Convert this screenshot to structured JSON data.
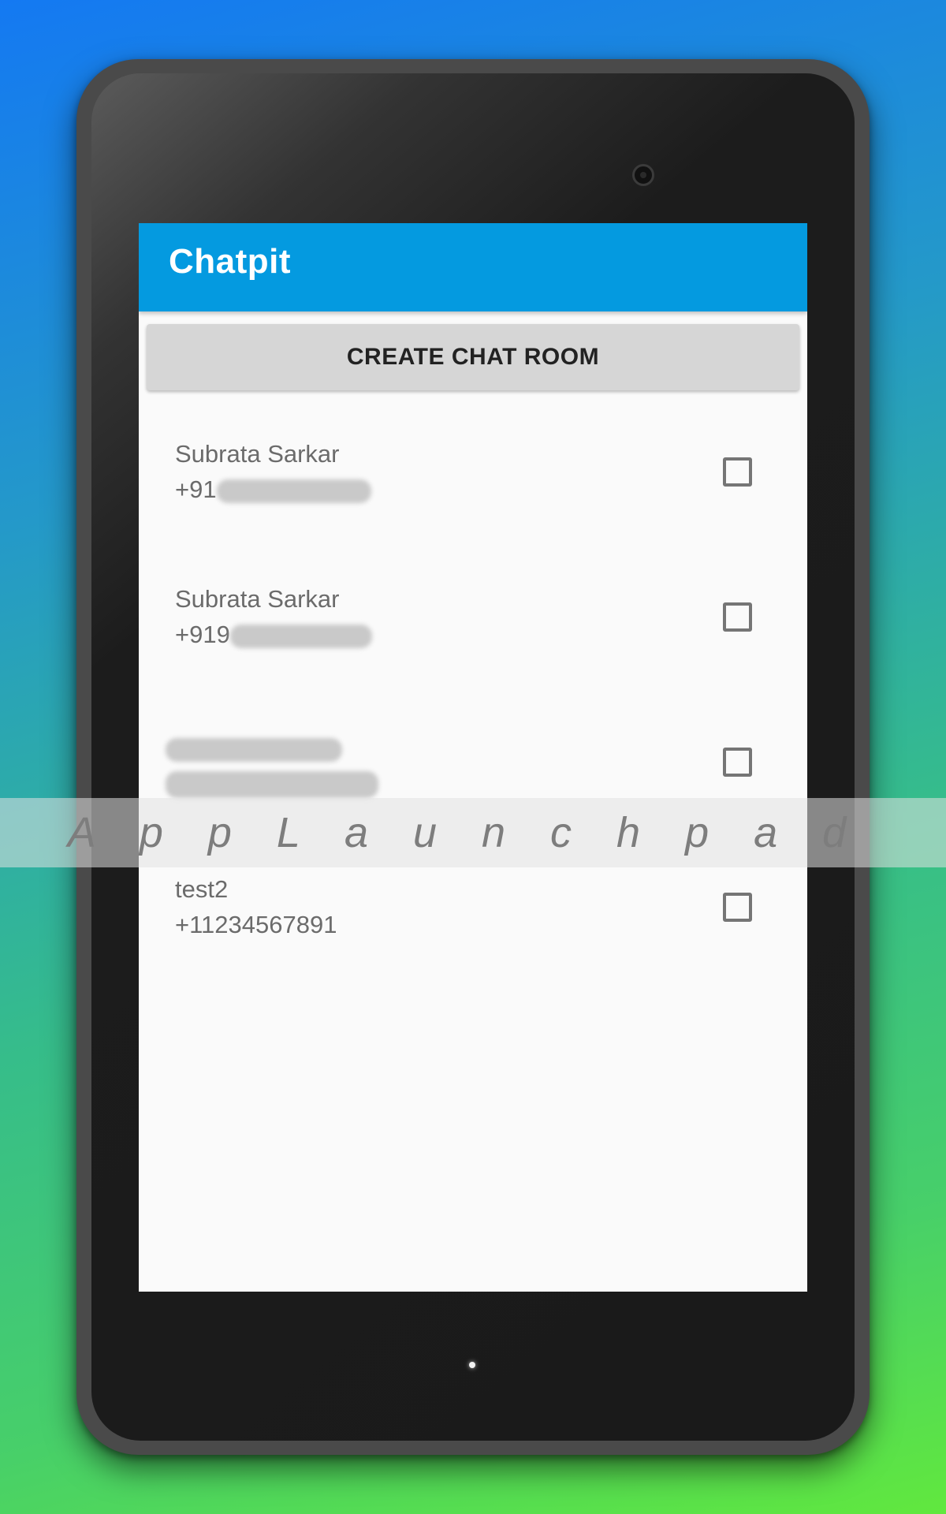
{
  "app": {
    "title": "Chatpit"
  },
  "actions": {
    "create_chat_room_label": "CREATE CHAT ROOM"
  },
  "contacts": [
    {
      "name": "Subrata Sarkar",
      "phone_visible": "+91",
      "checked": false
    },
    {
      "name": "Subrata Sarkar",
      "phone_visible": "+919",
      "checked": false
    },
    {
      "name": "",
      "phone_visible": "",
      "checked": false
    },
    {
      "name": "test2",
      "phone_visible": "+11234567891",
      "checked": false
    }
  ],
  "watermark": {
    "text": "A p p L a u n c h p a d"
  },
  "colors": {
    "app_bar": "#049ae0",
    "button_bg": "#d6d6d6",
    "screen_bg": "#fafafa",
    "text_secondary": "#6b6b6b"
  }
}
